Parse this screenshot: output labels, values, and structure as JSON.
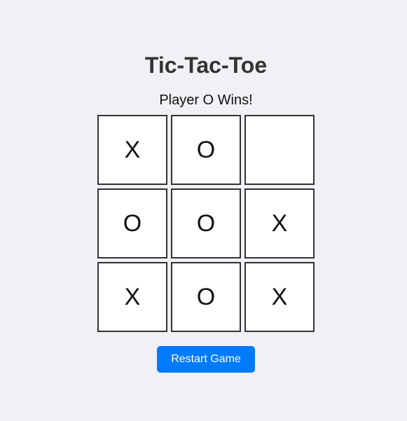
{
  "game": {
    "title": "Tic-Tac-Toe",
    "status": "Player O Wins!",
    "board": [
      "X",
      "O",
      "",
      "O",
      "O",
      "X",
      "X",
      "O",
      "X"
    ],
    "restart_label": "Restart Game"
  },
  "colors": {
    "background": "#f0f0f5",
    "accent": "#007bff",
    "cell_border": "#333333"
  }
}
